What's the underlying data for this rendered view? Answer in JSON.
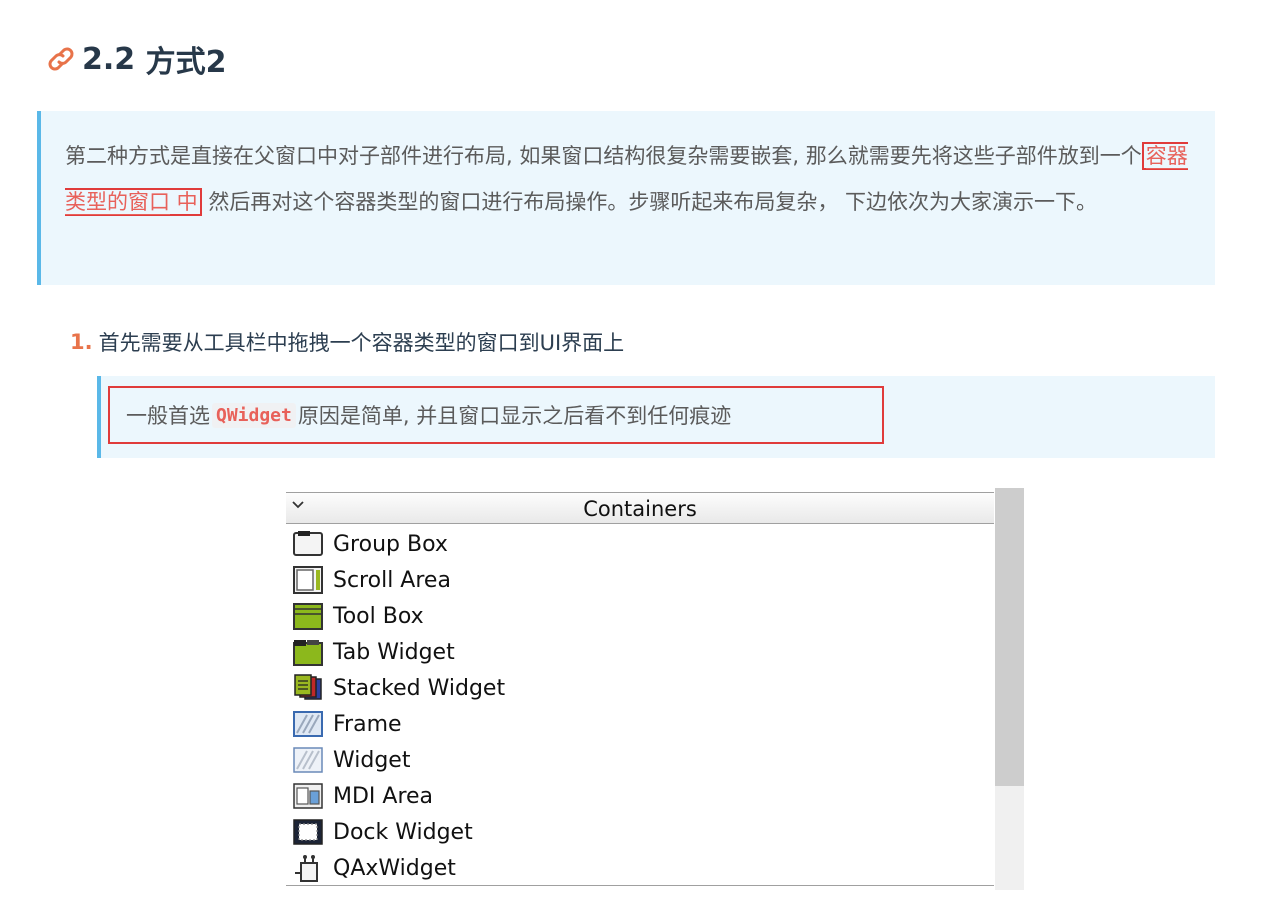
{
  "heading": {
    "number": "2.2",
    "title": "方式2"
  },
  "quote1": {
    "part1": "第二种方式是直接在父窗口中对子部件进行布局, 如果窗口结构很复杂需要嵌套, 那么就需要先将这些子部件放到一个",
    "highlight_link": "容器类型的窗口",
    "highlight_suffix": " 中",
    "part2": " 然后再对这个容器类型的窗口进行布局操作。步骤听起来布局复杂， 下边依次为大家演示一下。"
  },
  "list": {
    "item1_num": "1.",
    "item1_text": "首先需要从工具栏中拖拽一个容器类型的窗口到UI界面上"
  },
  "quote2": {
    "pre": "一般首选",
    "code": "QWidget",
    "post": "原因是简单, 并且窗口显示之后看不到任何痕迹"
  },
  "panel": {
    "title": "Containers",
    "items": [
      {
        "label": "Group Box",
        "icon": "group-box-icon"
      },
      {
        "label": "Scroll Area",
        "icon": "scroll-area-icon"
      },
      {
        "label": "Tool Box",
        "icon": "tool-box-icon"
      },
      {
        "label": "Tab Widget",
        "icon": "tab-widget-icon"
      },
      {
        "label": "Stacked Widget",
        "icon": "stacked-widget-icon"
      },
      {
        "label": "Frame",
        "icon": "frame-icon"
      },
      {
        "label": "Widget",
        "icon": "widget-icon"
      },
      {
        "label": "MDI Area",
        "icon": "mdi-area-icon"
      },
      {
        "label": "Dock Widget",
        "icon": "dock-widget-icon"
      },
      {
        "label": "QAxWidget",
        "icon": "qaxwidget-icon"
      }
    ]
  }
}
